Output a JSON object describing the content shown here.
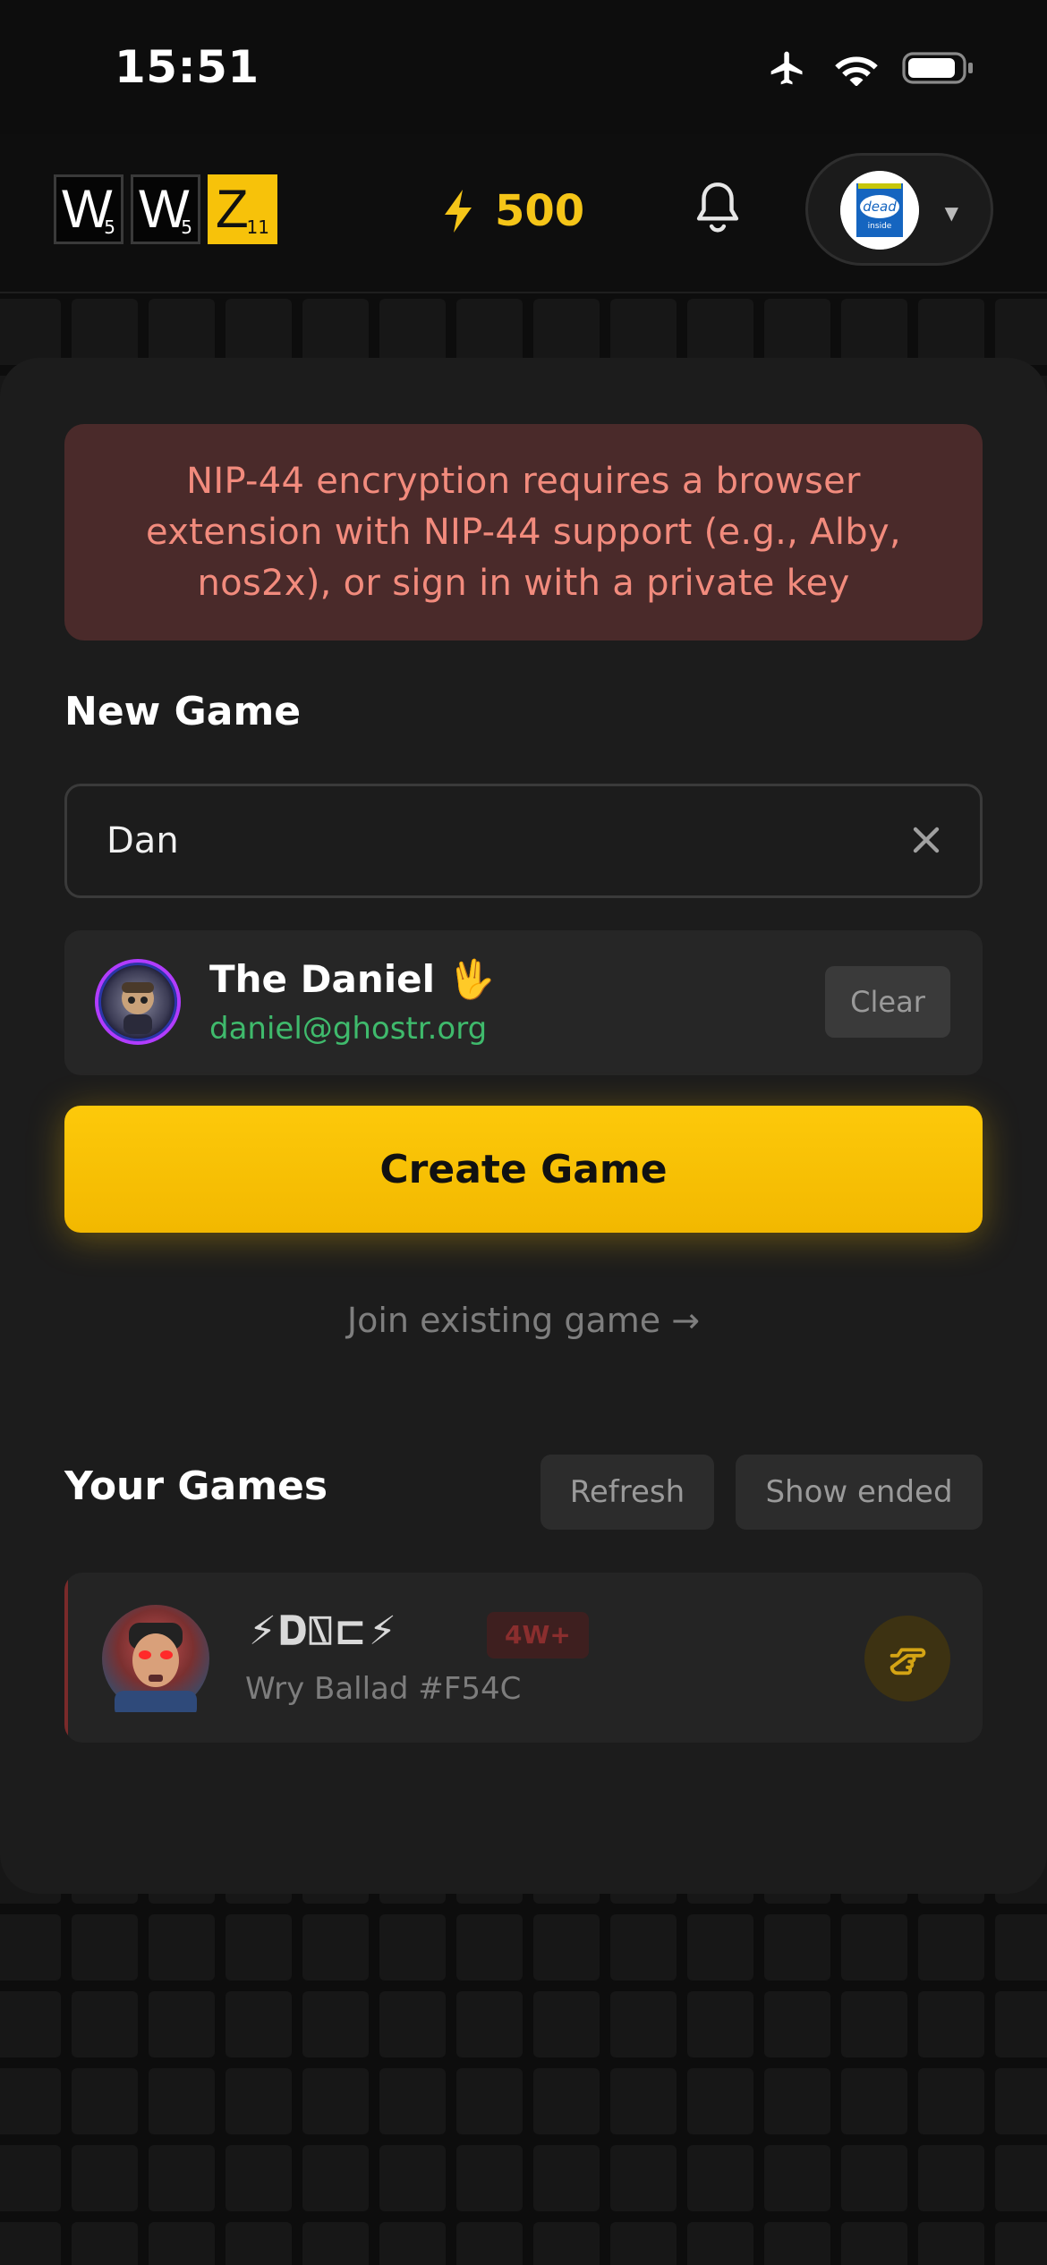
{
  "status_bar": {
    "time": "15:51",
    "icons": [
      "airplane-icon",
      "wifi-icon",
      "battery-icon"
    ]
  },
  "header": {
    "logo_tiles": [
      {
        "letter": "W",
        "value": "5"
      },
      {
        "letter": "W",
        "value": "5"
      },
      {
        "letter": "Z",
        "value": "11"
      }
    ],
    "balance": "500",
    "bolt_icon": "lightning-icon",
    "bell_icon": "bell-icon",
    "profile_badge": {
      "line1": "dead",
      "line2": "inside"
    },
    "accent_color": "#f5c518"
  },
  "alert": {
    "text": "NIP-44 encryption requires a browser extension with NIP-44 support (e.g., Alby, nos2x), or sign in with a private key"
  },
  "new_game": {
    "title": "New Game",
    "search_value": "Dan",
    "selected_user": {
      "name": "The Daniel 🖖",
      "email": "daniel@ghostr.org"
    },
    "clear_label": "Clear",
    "create_label": "Create Game",
    "join_label": "Join existing game →"
  },
  "your_games": {
    "title": "Your Games",
    "refresh_label": "Refresh",
    "show_ended_label": "Show ended",
    "games": [
      {
        "title": "⚡𝐃⍂⊏⚡",
        "badge": "4W+",
        "subtitle": "Wry Ballad #F54C"
      }
    ]
  }
}
